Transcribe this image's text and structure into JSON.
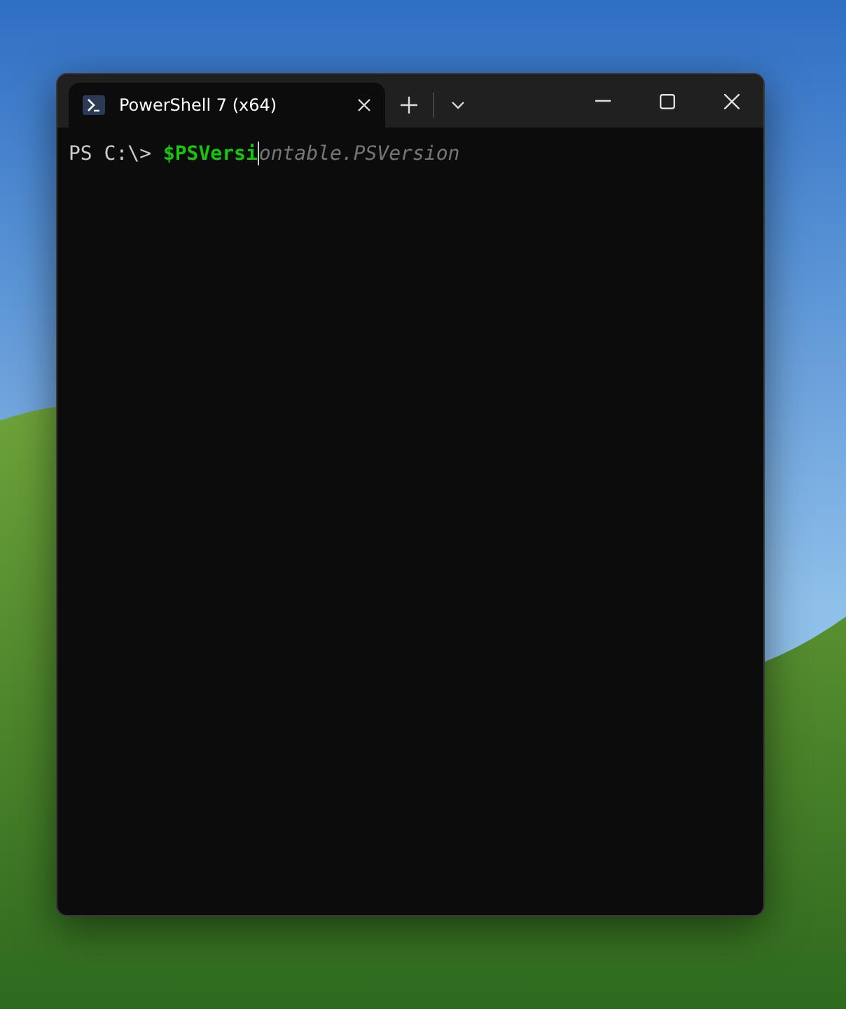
{
  "window": {
    "tabs": [
      {
        "title": "PowerShell 7 (x64)",
        "selected": true
      }
    ]
  },
  "terminal": {
    "lines": [
      {
        "prompt": "PS C:\\>",
        "input": "$PSVersi",
        "suggestion": "ontable.PSVersion"
      }
    ]
  }
}
